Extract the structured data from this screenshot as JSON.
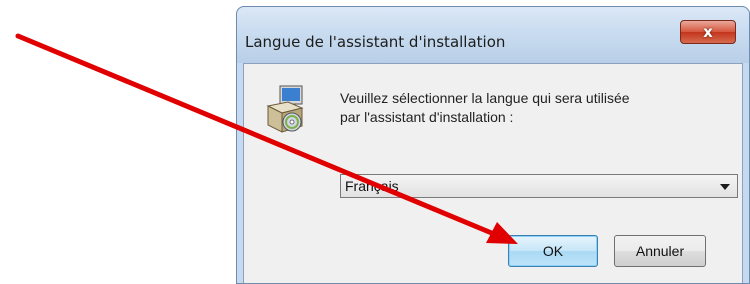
{
  "dialog": {
    "title": "Langue de l'assistant d'installation",
    "close_label": "x",
    "message_line1": "Veuillez sélectionner la langue qui sera utilisée",
    "message_line2": "par l'assistant d'installation :",
    "language_selected": "Français",
    "ok_label": "OK",
    "cancel_label": "Annuler"
  },
  "icons": {
    "setup": "setup-installer-icon",
    "dropdown": "chevron-down-icon",
    "annotation": "red-arrow-annotation"
  },
  "colors": {
    "annotation_arrow": "#e00000",
    "close_button": "#c8402a",
    "ok_button_border": "#3c7fb1"
  }
}
